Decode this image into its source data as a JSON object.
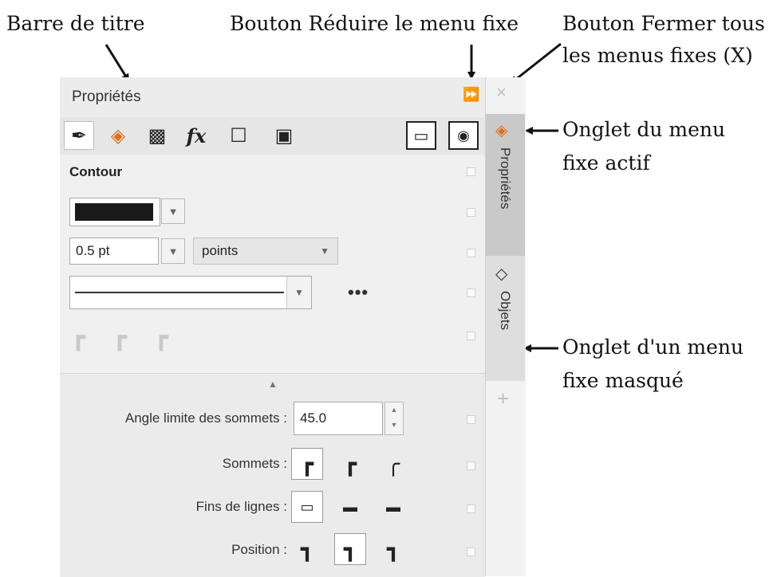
{
  "callouts": {
    "title_bar": "Barre de titre",
    "collapse_button": "Bouton Réduire le menu fixe",
    "close_all_line1": "Bouton Fermer tous",
    "close_all_line2": "les menus fixes (X)",
    "active_tab_line1": "Onglet du menu",
    "active_tab_line2": "fixe actif",
    "hidden_tab_line1": "Onglet d'un menu",
    "hidden_tab_line2": "fixe masqué"
  },
  "docker": {
    "title": "Propriétés",
    "collapse_glyph": "⏩",
    "close_glyph": "×",
    "toolbar": {
      "tools": [
        {
          "icon": "pen-nib-icon",
          "glyph": "✒"
        },
        {
          "icon": "fill-bucket-icon",
          "glyph": "◈"
        },
        {
          "icon": "transparency-checker-icon",
          "glyph": "▩"
        },
        {
          "icon": "effects-fx-icon",
          "glyph": "fx"
        },
        {
          "icon": "frame-icon",
          "glyph": "☐"
        },
        {
          "icon": "image-icon",
          "glyph": "▣"
        }
      ],
      "right_buttons": [
        {
          "icon": "maximize-docker-icon",
          "glyph": "▭"
        },
        {
          "icon": "preview-docker-icon",
          "glyph": "◉"
        }
      ]
    },
    "outline": {
      "heading": "Contour",
      "color_value": "#1a1a1a",
      "dropdown_glyph": "▼",
      "width_value": "0.5 pt",
      "units_value": "points",
      "more_glyph": "•••",
      "corners": [
        "┏",
        "┏",
        "┏"
      ]
    },
    "advanced": {
      "expand_glyph": "▲",
      "miter_label": "Angle limite des sommets :",
      "miter_value": "45.0",
      "spin_up": "▲",
      "spin_down": "▼",
      "corners_label": "Sommets :",
      "corner_options": [
        "┏",
        "┏",
        "╭"
      ],
      "line_caps_label": "Fins de lignes :",
      "cap_options": [
        "▭",
        "▬",
        "▬"
      ],
      "position_label": "Position :",
      "position_options": [
        "┓",
        "┓",
        "┓"
      ]
    },
    "tabs": {
      "active_label": "Propriétés",
      "active_icon_glyph": "◈",
      "hidden_label": "Objets",
      "hidden_icon_glyph": "◇",
      "add_glyph": "+"
    }
  }
}
